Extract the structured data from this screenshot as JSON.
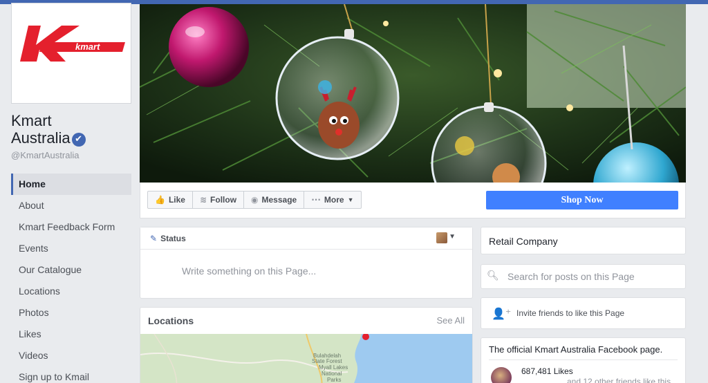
{
  "page": {
    "name_line1": "Kmart",
    "name_line2": "Australia",
    "verified_glyph": "✔",
    "handle": "@KmartAustralia",
    "brand_color": "#e4202d",
    "accent_color": "#4267b2"
  },
  "logo": {
    "text": "kmart"
  },
  "nav": {
    "items": [
      {
        "label": "Home",
        "active": true
      },
      {
        "label": "About"
      },
      {
        "label": "Kmart Feedback Form"
      },
      {
        "label": "Events"
      },
      {
        "label": "Our Catalogue"
      },
      {
        "label": "Locations"
      },
      {
        "label": "Photos"
      },
      {
        "label": "Likes"
      },
      {
        "label": "Videos"
      },
      {
        "label": "Sign up to Kmail"
      }
    ]
  },
  "actions": {
    "like": "Like",
    "follow": "Follow",
    "message": "Message",
    "more": "More",
    "shop_now": "Shop Now",
    "like_icon": "thumbs-up-icon",
    "follow_icon": "rss-icon",
    "message_icon": "messenger-icon",
    "more_icon": "ellipsis-icon"
  },
  "composer": {
    "tab_label": "Status",
    "placeholder": "Write something on this Page..."
  },
  "locations": {
    "title": "Locations",
    "see_all": "See All",
    "map_labels": [
      "Bulahdelah",
      "State Forest",
      "Myall Lakes",
      "National",
      "Parks"
    ]
  },
  "sidebar_right": {
    "category": "Retail Company",
    "search_placeholder": "Search for posts on this Page",
    "invite_text": "Invite friends to like this Page",
    "about_text": "The official Kmart Australia Facebook page.",
    "likes_count": "687,481 Likes",
    "friends_like": "and 12 other friends like this"
  }
}
